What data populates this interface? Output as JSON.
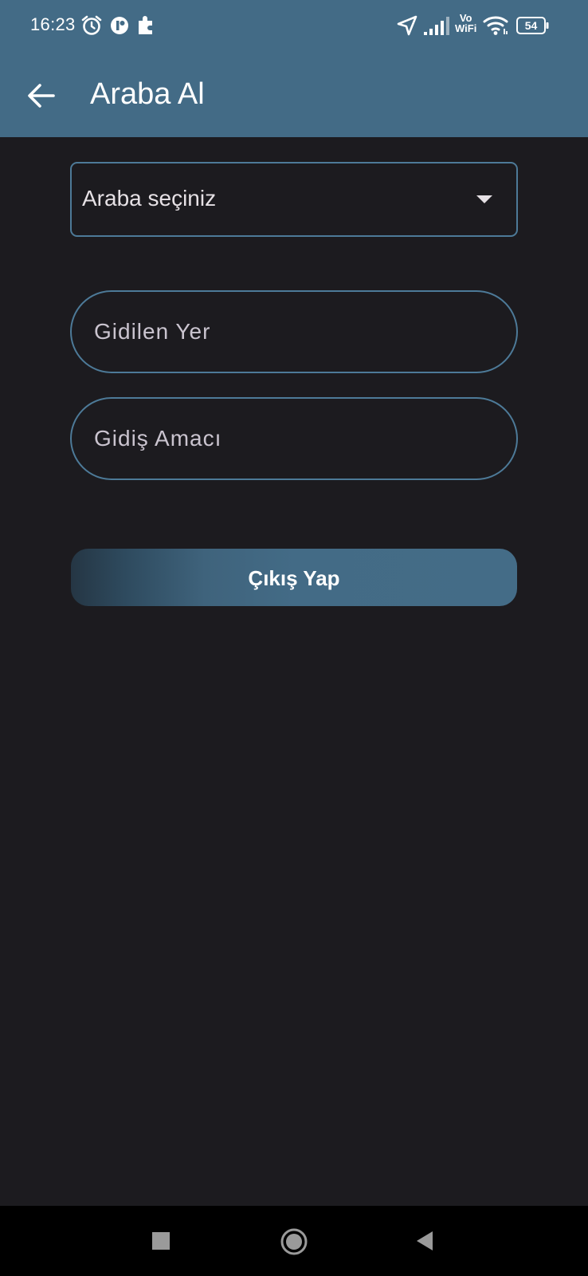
{
  "status_bar": {
    "time": "16:23",
    "vowifi_top": "Vo",
    "vowifi_bottom": "WiFi",
    "battery_level": "54",
    "icons": [
      "alarm-icon",
      "app-notification-icon",
      "extension-icon",
      "location-arrow-icon",
      "signal-icon",
      "vowifi-icon",
      "wifi-icon",
      "battery-icon"
    ]
  },
  "app_bar": {
    "title": "Araba Al",
    "back_icon": "arrow-left-icon"
  },
  "form": {
    "car_select": {
      "value": "Araba seçiniz",
      "icon": "dropdown-arrow-icon"
    },
    "destination": {
      "placeholder": "Gidilen Yer",
      "value": ""
    },
    "purpose": {
      "placeholder": "Gidiş Amacı",
      "value": ""
    },
    "submit_label": "Çıkış Yap"
  },
  "nav_bar": {
    "icons": [
      "recents-square-icon",
      "home-circle-icon",
      "back-triangle-icon"
    ]
  },
  "colors": {
    "header": "#436b86",
    "background": "#1c1b1f",
    "outline": "#4d7a98",
    "text": "#e6e1e5",
    "nav_bar": "#000000"
  }
}
